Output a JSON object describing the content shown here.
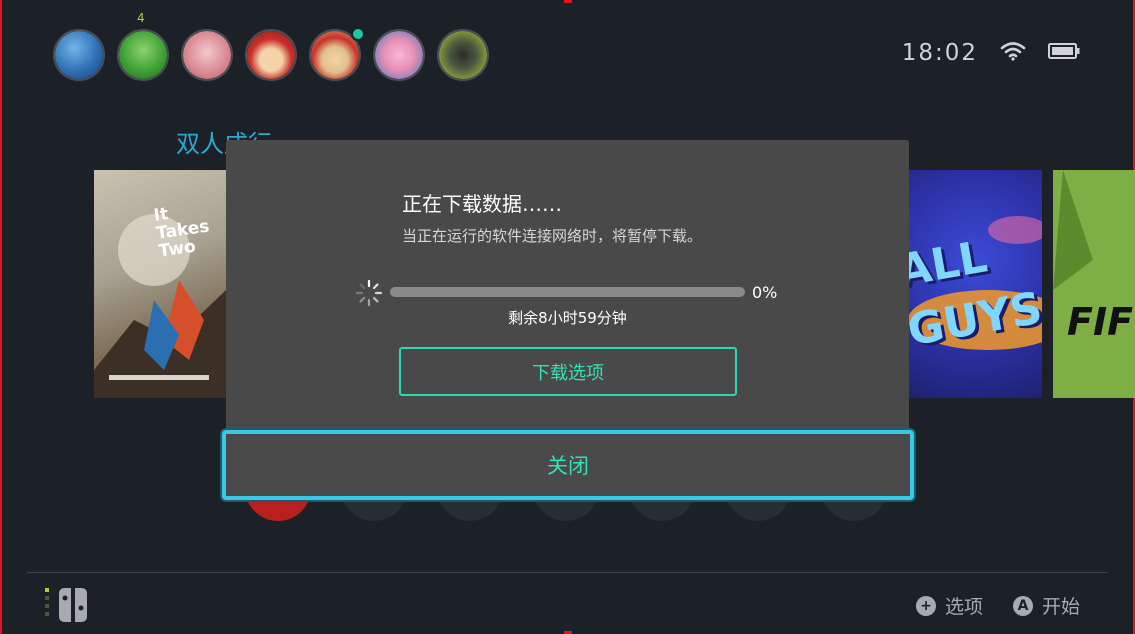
{
  "header": {
    "time": "18:02",
    "users": [
      {
        "name": "user-1",
        "color": "#2f6fb5",
        "badge": ""
      },
      {
        "name": "user-2",
        "color": "#3fa236",
        "badge": "4"
      },
      {
        "name": "user-3",
        "color": "#d8878e",
        "badge": ""
      },
      {
        "name": "user-4",
        "color": "#c9302c",
        "badge": ""
      },
      {
        "name": "user-5",
        "color": "#d8b86a",
        "badge": ""
      },
      {
        "name": "user-6",
        "color": "#e98fb4",
        "badge": ""
      },
      {
        "name": "user-7",
        "color": "#b8cf34",
        "badge": ""
      }
    ]
  },
  "row_title": "双人成行",
  "tiles": {
    "left_art": "It Takes Two",
    "center_art": "ALL GUYS",
    "right_art": "FIF"
  },
  "dialog": {
    "title": "正在下载数据……",
    "subtitle": "当正在运行的软件连接网络时，将暂停下载。",
    "progress_percent": 0,
    "progress_label": "0%",
    "remaining": "剩余8小时59分钟",
    "options_button": "下载选项",
    "close_button": "关闭"
  },
  "footer": {
    "options_label": "选项",
    "options_icon_glyph": "+",
    "start_label": "开始",
    "start_icon_glyph": "A"
  },
  "colors": {
    "accent_teal": "#2dd9b0",
    "focus_blue": "#3cc8e4",
    "background": "#1b2126",
    "dialog": "#494949"
  }
}
